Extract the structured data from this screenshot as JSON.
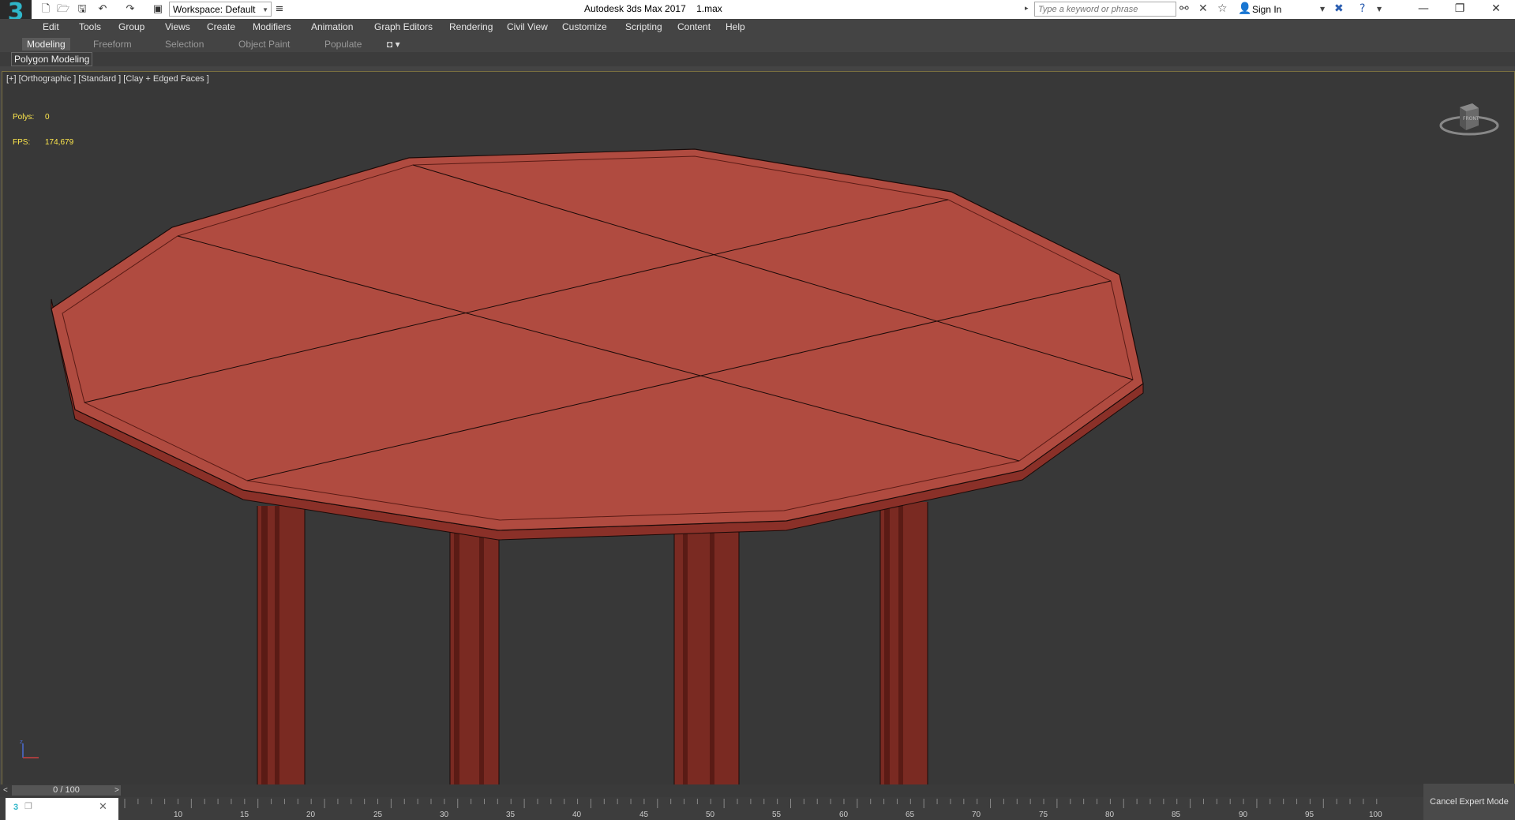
{
  "titlebar": {
    "app_logo": "3",
    "workspace": "Workspace: Default",
    "title": "Autodesk 3ds Max 2017",
    "filename": "1.max",
    "search_placeholder": "Type a keyword or phrase",
    "sign_in": "Sign In"
  },
  "menu": [
    "Edit",
    "Tools",
    "Group",
    "Views",
    "Create",
    "Modifiers",
    "Animation",
    "Graph Editors",
    "Rendering",
    "Civil View",
    "Customize",
    "Scripting",
    "Content",
    "Help"
  ],
  "ribbon": {
    "tabs": [
      "Modeling",
      "Freeform",
      "Selection",
      "Object Paint",
      "Populate"
    ],
    "active": "Modeling",
    "panel": "Polygon Modeling"
  },
  "viewport": {
    "label": "[+] [Orthographic ] [Standard ] [Clay + Edged Faces ]",
    "polys_label": "Polys:",
    "polys_value": "0",
    "fps_label": "FPS:",
    "fps_value": "174,679",
    "viewcube_face": "FRONT",
    "object_color": "#b04b40"
  },
  "timeline": {
    "slider": "0 / 100",
    "ticks": [
      "10",
      "15",
      "20",
      "25",
      "30",
      "35",
      "40",
      "45",
      "50",
      "55",
      "60",
      "65",
      "70",
      "75",
      "80",
      "85",
      "90",
      "95",
      "100"
    ]
  },
  "status": {
    "cancel_expert": "Cancel Expert Mode"
  },
  "icons": [
    "new-file-icon",
    "open-file-icon",
    "save-icon",
    "undo-icon",
    "redo-icon",
    "project-icon",
    "search-binoculars-icon",
    "tools-icon",
    "star-icon",
    "user-icon",
    "exchange-icon",
    "help-icon",
    "minimize-icon",
    "restore-icon",
    "close-icon"
  ]
}
